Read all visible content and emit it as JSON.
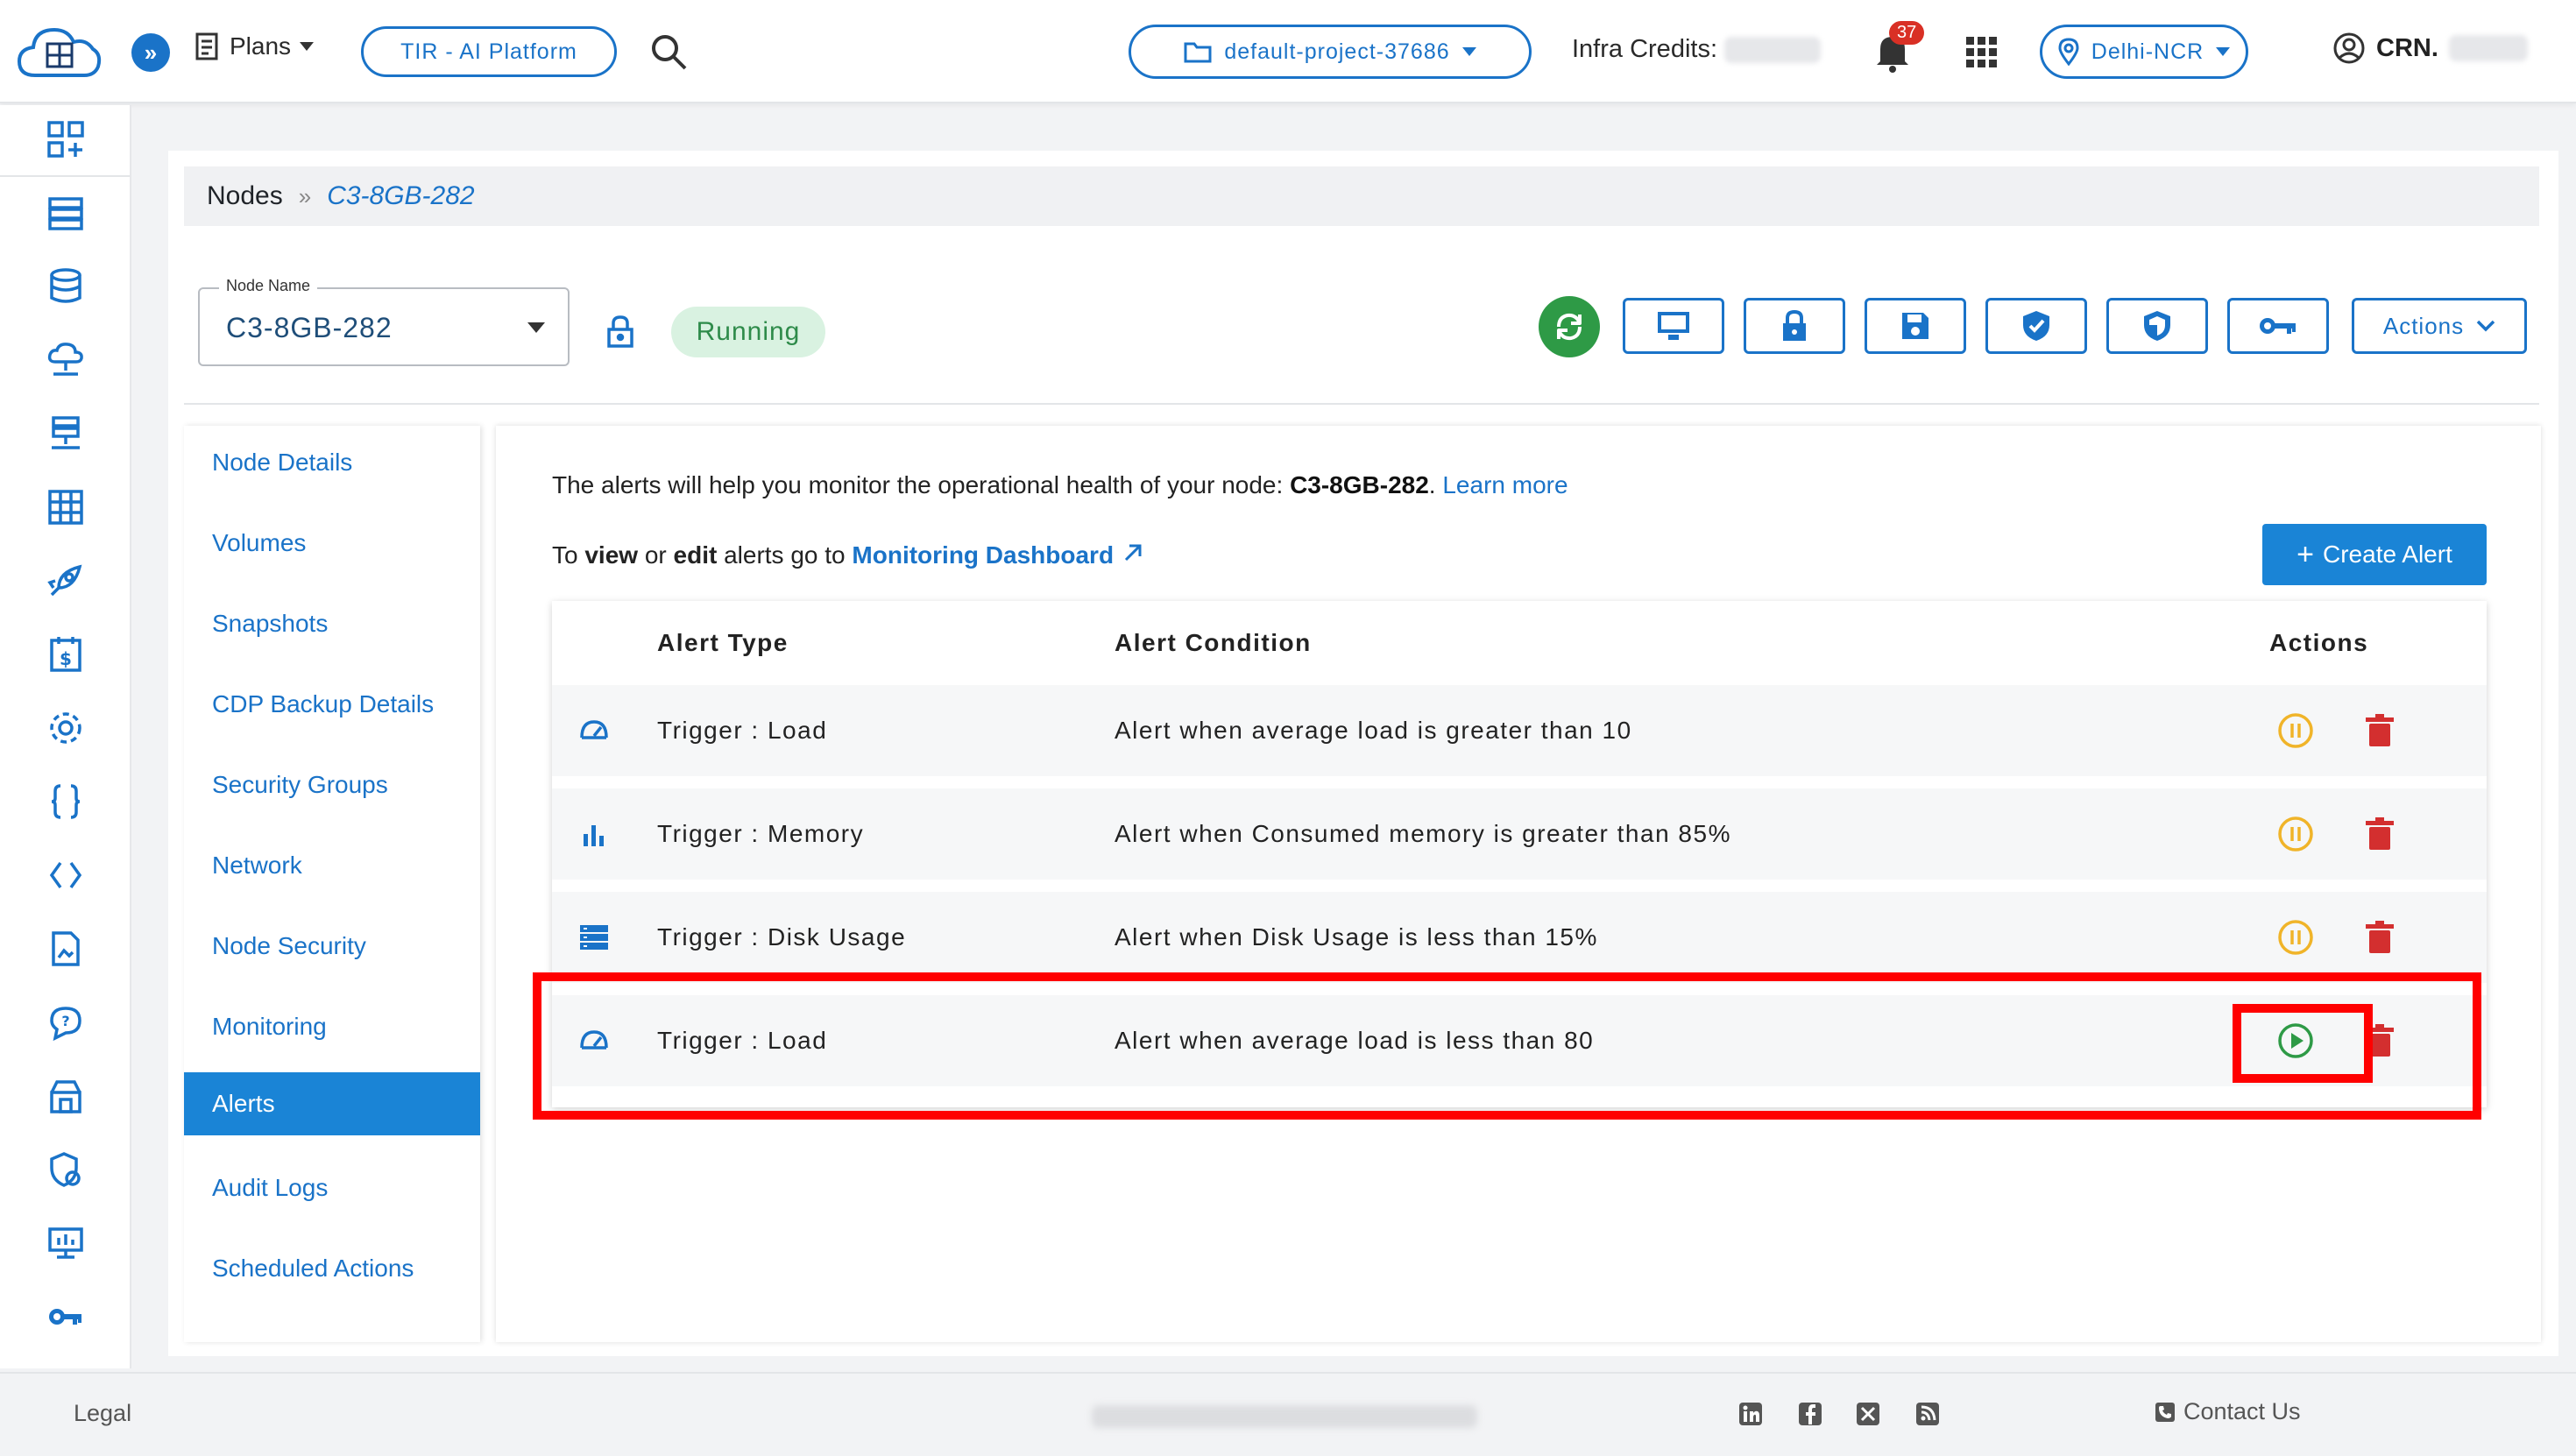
{
  "topbar": {
    "plans_label": "Plans",
    "platform_label": "TIR - AI Platform",
    "project_label": "default-project-37686",
    "credits_label": "Infra Credits:",
    "notification_count": "37",
    "region_label": "Delhi-NCR",
    "user_label": "CRN."
  },
  "breadcrumb": {
    "root": "Nodes",
    "separator": "»",
    "current": "C3-8GB-282"
  },
  "node": {
    "field_label": "Node Name",
    "name": "C3-8GB-282",
    "status": "Running",
    "actions_label": "Actions"
  },
  "sidebar": {
    "items": [
      {
        "label": "Node Details"
      },
      {
        "label": "Volumes"
      },
      {
        "label": "Snapshots"
      },
      {
        "label": "CDP Backup Details"
      },
      {
        "label": "Security Groups"
      },
      {
        "label": "Network"
      },
      {
        "label": "Node Security"
      },
      {
        "label": "Monitoring"
      },
      {
        "label": "Alerts"
      },
      {
        "label": "Audit Logs"
      },
      {
        "label": "Scheduled Actions"
      }
    ],
    "active": "Alerts"
  },
  "alerts": {
    "intro_text": "The alerts will help you monitor the operational health of your node: ",
    "intro_node": "C3-8GB-282",
    "intro_period": ".",
    "learn_more": "Learn more",
    "to_text": "To ",
    "view_text": "view",
    "or_text": " or ",
    "edit_text": "edit",
    "goto_text": " alerts go to ",
    "dashboard_link": "Monitoring Dashboard",
    "create_label": "Create Alert",
    "columns": {
      "type": "Alert Type",
      "condition": "Alert Condition",
      "actions": "Actions"
    },
    "rows": [
      {
        "type": "Trigger : Load",
        "condition": "Alert when average load is greater than 10",
        "icon": "speedometer-icon",
        "state": "active"
      },
      {
        "type": "Trigger : Memory",
        "condition": "Alert when Consumed memory is greater than 85%",
        "icon": "bar-chart-icon",
        "state": "active"
      },
      {
        "type": "Trigger : Disk Usage",
        "condition": "Alert when Disk Usage is less than 15%",
        "icon": "storage-icon",
        "state": "active"
      },
      {
        "type": "Trigger : Load",
        "condition": "Alert when average load is less than 80",
        "icon": "speedometer-icon",
        "state": "paused"
      }
    ]
  },
  "footer": {
    "legal": "Legal",
    "contact": "Contact Us"
  },
  "colors": {
    "primary": "#1a73c8",
    "success": "#2e9a46",
    "danger": "#d32f2f",
    "warning": "#f0b429",
    "highlight": "#ff0000"
  }
}
